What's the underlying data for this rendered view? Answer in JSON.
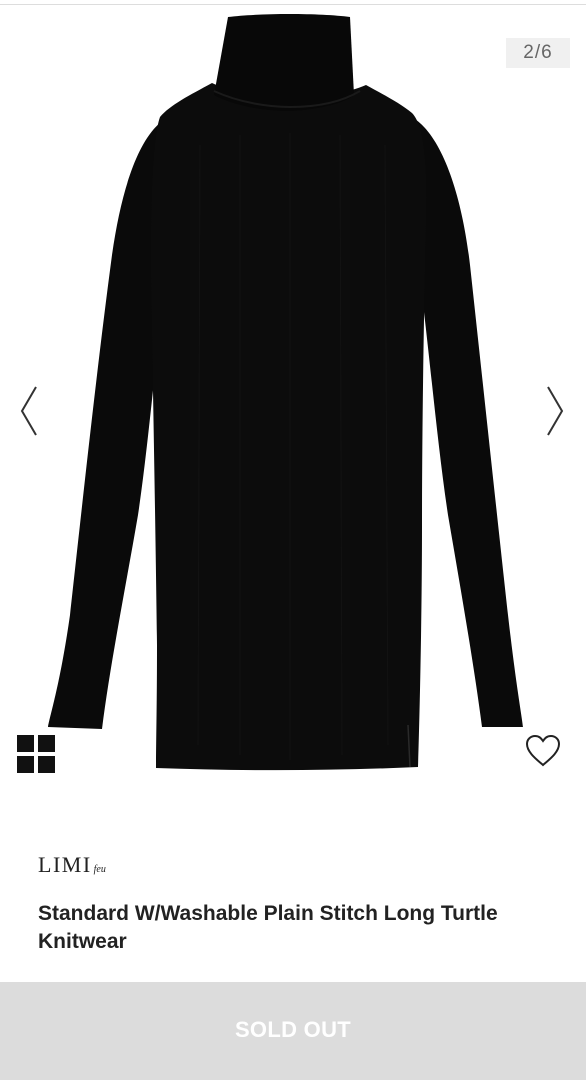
{
  "gallery": {
    "counter": "2/6",
    "current_index": 2,
    "total_images": 6,
    "image_alt": "Black long ribbed turtleneck knit",
    "prev_icon": "chevron-left-icon",
    "next_icon": "chevron-right-icon",
    "thumbnail_icon": "grid-icon",
    "favorite_icon": "heart-icon"
  },
  "product": {
    "brand": "LIMI",
    "brand_sub": "feu",
    "title": "Standard W/Washable Plain Stitch Long Turtle Knitwear"
  },
  "action": {
    "label": "SOLD OUT"
  },
  "colors": {
    "garment": "#0b0b0b",
    "sold_out_bg": "#dcdcdc",
    "counter_bg": "#f0f0f0"
  }
}
